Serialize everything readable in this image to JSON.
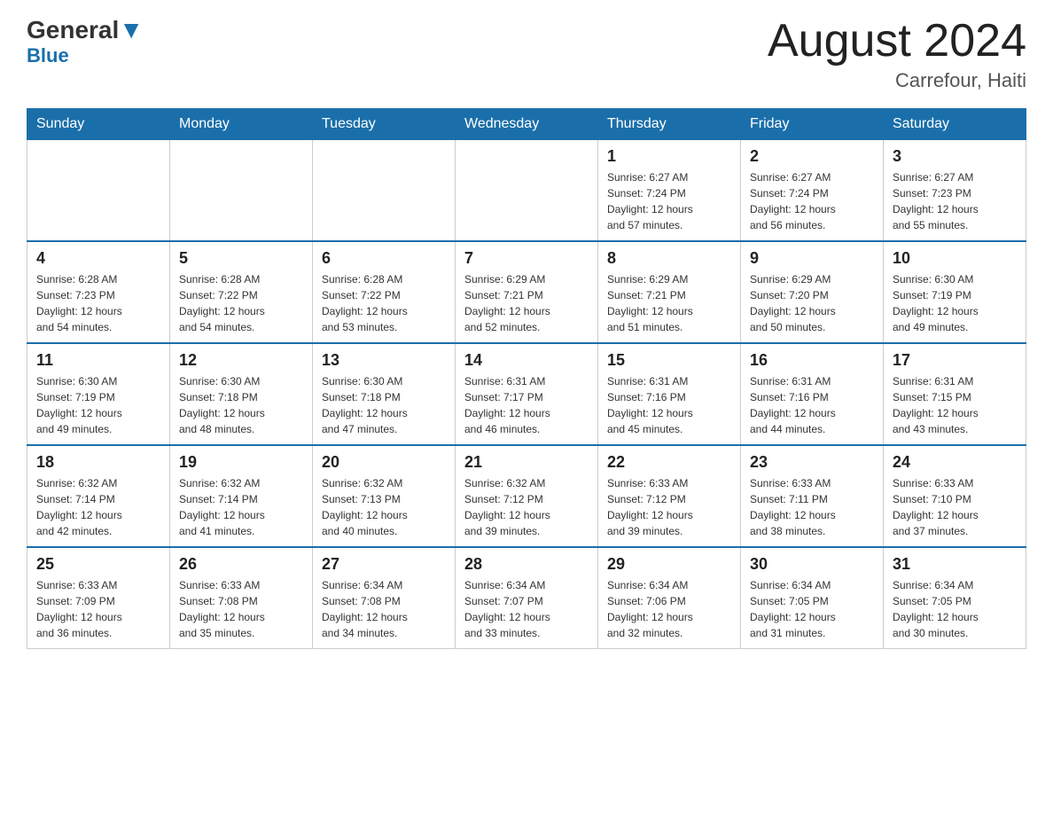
{
  "header": {
    "logo_general": "General",
    "logo_blue": "Blue",
    "month_title": "August 2024",
    "location": "Carrefour, Haiti"
  },
  "days_of_week": [
    "Sunday",
    "Monday",
    "Tuesday",
    "Wednesday",
    "Thursday",
    "Friday",
    "Saturday"
  ],
  "weeks": [
    [
      {
        "day": "",
        "info": ""
      },
      {
        "day": "",
        "info": ""
      },
      {
        "day": "",
        "info": ""
      },
      {
        "day": "",
        "info": ""
      },
      {
        "day": "1",
        "info": "Sunrise: 6:27 AM\nSunset: 7:24 PM\nDaylight: 12 hours\nand 57 minutes."
      },
      {
        "day": "2",
        "info": "Sunrise: 6:27 AM\nSunset: 7:24 PM\nDaylight: 12 hours\nand 56 minutes."
      },
      {
        "day": "3",
        "info": "Sunrise: 6:27 AM\nSunset: 7:23 PM\nDaylight: 12 hours\nand 55 minutes."
      }
    ],
    [
      {
        "day": "4",
        "info": "Sunrise: 6:28 AM\nSunset: 7:23 PM\nDaylight: 12 hours\nand 54 minutes."
      },
      {
        "day": "5",
        "info": "Sunrise: 6:28 AM\nSunset: 7:22 PM\nDaylight: 12 hours\nand 54 minutes."
      },
      {
        "day": "6",
        "info": "Sunrise: 6:28 AM\nSunset: 7:22 PM\nDaylight: 12 hours\nand 53 minutes."
      },
      {
        "day": "7",
        "info": "Sunrise: 6:29 AM\nSunset: 7:21 PM\nDaylight: 12 hours\nand 52 minutes."
      },
      {
        "day": "8",
        "info": "Sunrise: 6:29 AM\nSunset: 7:21 PM\nDaylight: 12 hours\nand 51 minutes."
      },
      {
        "day": "9",
        "info": "Sunrise: 6:29 AM\nSunset: 7:20 PM\nDaylight: 12 hours\nand 50 minutes."
      },
      {
        "day": "10",
        "info": "Sunrise: 6:30 AM\nSunset: 7:19 PM\nDaylight: 12 hours\nand 49 minutes."
      }
    ],
    [
      {
        "day": "11",
        "info": "Sunrise: 6:30 AM\nSunset: 7:19 PM\nDaylight: 12 hours\nand 49 minutes."
      },
      {
        "day": "12",
        "info": "Sunrise: 6:30 AM\nSunset: 7:18 PM\nDaylight: 12 hours\nand 48 minutes."
      },
      {
        "day": "13",
        "info": "Sunrise: 6:30 AM\nSunset: 7:18 PM\nDaylight: 12 hours\nand 47 minutes."
      },
      {
        "day": "14",
        "info": "Sunrise: 6:31 AM\nSunset: 7:17 PM\nDaylight: 12 hours\nand 46 minutes."
      },
      {
        "day": "15",
        "info": "Sunrise: 6:31 AM\nSunset: 7:16 PM\nDaylight: 12 hours\nand 45 minutes."
      },
      {
        "day": "16",
        "info": "Sunrise: 6:31 AM\nSunset: 7:16 PM\nDaylight: 12 hours\nand 44 minutes."
      },
      {
        "day": "17",
        "info": "Sunrise: 6:31 AM\nSunset: 7:15 PM\nDaylight: 12 hours\nand 43 minutes."
      }
    ],
    [
      {
        "day": "18",
        "info": "Sunrise: 6:32 AM\nSunset: 7:14 PM\nDaylight: 12 hours\nand 42 minutes."
      },
      {
        "day": "19",
        "info": "Sunrise: 6:32 AM\nSunset: 7:14 PM\nDaylight: 12 hours\nand 41 minutes."
      },
      {
        "day": "20",
        "info": "Sunrise: 6:32 AM\nSunset: 7:13 PM\nDaylight: 12 hours\nand 40 minutes."
      },
      {
        "day": "21",
        "info": "Sunrise: 6:32 AM\nSunset: 7:12 PM\nDaylight: 12 hours\nand 39 minutes."
      },
      {
        "day": "22",
        "info": "Sunrise: 6:33 AM\nSunset: 7:12 PM\nDaylight: 12 hours\nand 39 minutes."
      },
      {
        "day": "23",
        "info": "Sunrise: 6:33 AM\nSunset: 7:11 PM\nDaylight: 12 hours\nand 38 minutes."
      },
      {
        "day": "24",
        "info": "Sunrise: 6:33 AM\nSunset: 7:10 PM\nDaylight: 12 hours\nand 37 minutes."
      }
    ],
    [
      {
        "day": "25",
        "info": "Sunrise: 6:33 AM\nSunset: 7:09 PM\nDaylight: 12 hours\nand 36 minutes."
      },
      {
        "day": "26",
        "info": "Sunrise: 6:33 AM\nSunset: 7:08 PM\nDaylight: 12 hours\nand 35 minutes."
      },
      {
        "day": "27",
        "info": "Sunrise: 6:34 AM\nSunset: 7:08 PM\nDaylight: 12 hours\nand 34 minutes."
      },
      {
        "day": "28",
        "info": "Sunrise: 6:34 AM\nSunset: 7:07 PM\nDaylight: 12 hours\nand 33 minutes."
      },
      {
        "day": "29",
        "info": "Sunrise: 6:34 AM\nSunset: 7:06 PM\nDaylight: 12 hours\nand 32 minutes."
      },
      {
        "day": "30",
        "info": "Sunrise: 6:34 AM\nSunset: 7:05 PM\nDaylight: 12 hours\nand 31 minutes."
      },
      {
        "day": "31",
        "info": "Sunrise: 6:34 AM\nSunset: 7:05 PM\nDaylight: 12 hours\nand 30 minutes."
      }
    ]
  ]
}
